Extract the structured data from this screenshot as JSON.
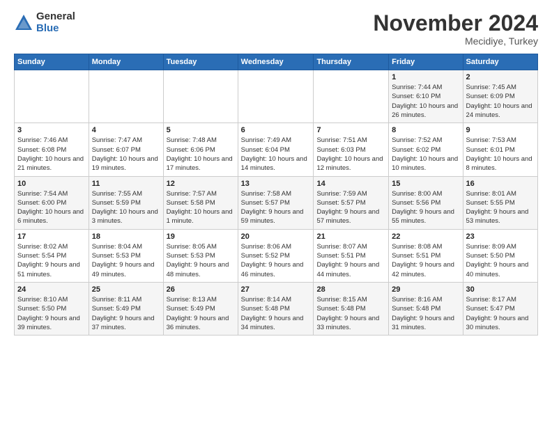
{
  "header": {
    "logo_general": "General",
    "logo_blue": "Blue",
    "month_title": "November 2024",
    "location": "Mecidiye, Turkey"
  },
  "calendar": {
    "headers": [
      "Sunday",
      "Monday",
      "Tuesday",
      "Wednesday",
      "Thursday",
      "Friday",
      "Saturday"
    ],
    "rows": [
      [
        {
          "day": "",
          "info": ""
        },
        {
          "day": "",
          "info": ""
        },
        {
          "day": "",
          "info": ""
        },
        {
          "day": "",
          "info": ""
        },
        {
          "day": "",
          "info": ""
        },
        {
          "day": "1",
          "info": "Sunrise: 7:44 AM\nSunset: 6:10 PM\nDaylight: 10 hours and 26 minutes."
        },
        {
          "day": "2",
          "info": "Sunrise: 7:45 AM\nSunset: 6:09 PM\nDaylight: 10 hours and 24 minutes."
        }
      ],
      [
        {
          "day": "3",
          "info": "Sunrise: 7:46 AM\nSunset: 6:08 PM\nDaylight: 10 hours and 21 minutes."
        },
        {
          "day": "4",
          "info": "Sunrise: 7:47 AM\nSunset: 6:07 PM\nDaylight: 10 hours and 19 minutes."
        },
        {
          "day": "5",
          "info": "Sunrise: 7:48 AM\nSunset: 6:06 PM\nDaylight: 10 hours and 17 minutes."
        },
        {
          "day": "6",
          "info": "Sunrise: 7:49 AM\nSunset: 6:04 PM\nDaylight: 10 hours and 14 minutes."
        },
        {
          "day": "7",
          "info": "Sunrise: 7:51 AM\nSunset: 6:03 PM\nDaylight: 10 hours and 12 minutes."
        },
        {
          "day": "8",
          "info": "Sunrise: 7:52 AM\nSunset: 6:02 PM\nDaylight: 10 hours and 10 minutes."
        },
        {
          "day": "9",
          "info": "Sunrise: 7:53 AM\nSunset: 6:01 PM\nDaylight: 10 hours and 8 minutes."
        }
      ],
      [
        {
          "day": "10",
          "info": "Sunrise: 7:54 AM\nSunset: 6:00 PM\nDaylight: 10 hours and 6 minutes."
        },
        {
          "day": "11",
          "info": "Sunrise: 7:55 AM\nSunset: 5:59 PM\nDaylight: 10 hours and 3 minutes."
        },
        {
          "day": "12",
          "info": "Sunrise: 7:57 AM\nSunset: 5:58 PM\nDaylight: 10 hours and 1 minute."
        },
        {
          "day": "13",
          "info": "Sunrise: 7:58 AM\nSunset: 5:57 PM\nDaylight: 9 hours and 59 minutes."
        },
        {
          "day": "14",
          "info": "Sunrise: 7:59 AM\nSunset: 5:57 PM\nDaylight: 9 hours and 57 minutes."
        },
        {
          "day": "15",
          "info": "Sunrise: 8:00 AM\nSunset: 5:56 PM\nDaylight: 9 hours and 55 minutes."
        },
        {
          "day": "16",
          "info": "Sunrise: 8:01 AM\nSunset: 5:55 PM\nDaylight: 9 hours and 53 minutes."
        }
      ],
      [
        {
          "day": "17",
          "info": "Sunrise: 8:02 AM\nSunset: 5:54 PM\nDaylight: 9 hours and 51 minutes."
        },
        {
          "day": "18",
          "info": "Sunrise: 8:04 AM\nSunset: 5:53 PM\nDaylight: 9 hours and 49 minutes."
        },
        {
          "day": "19",
          "info": "Sunrise: 8:05 AM\nSunset: 5:53 PM\nDaylight: 9 hours and 48 minutes."
        },
        {
          "day": "20",
          "info": "Sunrise: 8:06 AM\nSunset: 5:52 PM\nDaylight: 9 hours and 46 minutes."
        },
        {
          "day": "21",
          "info": "Sunrise: 8:07 AM\nSunset: 5:51 PM\nDaylight: 9 hours and 44 minutes."
        },
        {
          "day": "22",
          "info": "Sunrise: 8:08 AM\nSunset: 5:51 PM\nDaylight: 9 hours and 42 minutes."
        },
        {
          "day": "23",
          "info": "Sunrise: 8:09 AM\nSunset: 5:50 PM\nDaylight: 9 hours and 40 minutes."
        }
      ],
      [
        {
          "day": "24",
          "info": "Sunrise: 8:10 AM\nSunset: 5:50 PM\nDaylight: 9 hours and 39 minutes."
        },
        {
          "day": "25",
          "info": "Sunrise: 8:11 AM\nSunset: 5:49 PM\nDaylight: 9 hours and 37 minutes."
        },
        {
          "day": "26",
          "info": "Sunrise: 8:13 AM\nSunset: 5:49 PM\nDaylight: 9 hours and 36 minutes."
        },
        {
          "day": "27",
          "info": "Sunrise: 8:14 AM\nSunset: 5:48 PM\nDaylight: 9 hours and 34 minutes."
        },
        {
          "day": "28",
          "info": "Sunrise: 8:15 AM\nSunset: 5:48 PM\nDaylight: 9 hours and 33 minutes."
        },
        {
          "day": "29",
          "info": "Sunrise: 8:16 AM\nSunset: 5:48 PM\nDaylight: 9 hours and 31 minutes."
        },
        {
          "day": "30",
          "info": "Sunrise: 8:17 AM\nSunset: 5:47 PM\nDaylight: 9 hours and 30 minutes."
        }
      ]
    ]
  }
}
